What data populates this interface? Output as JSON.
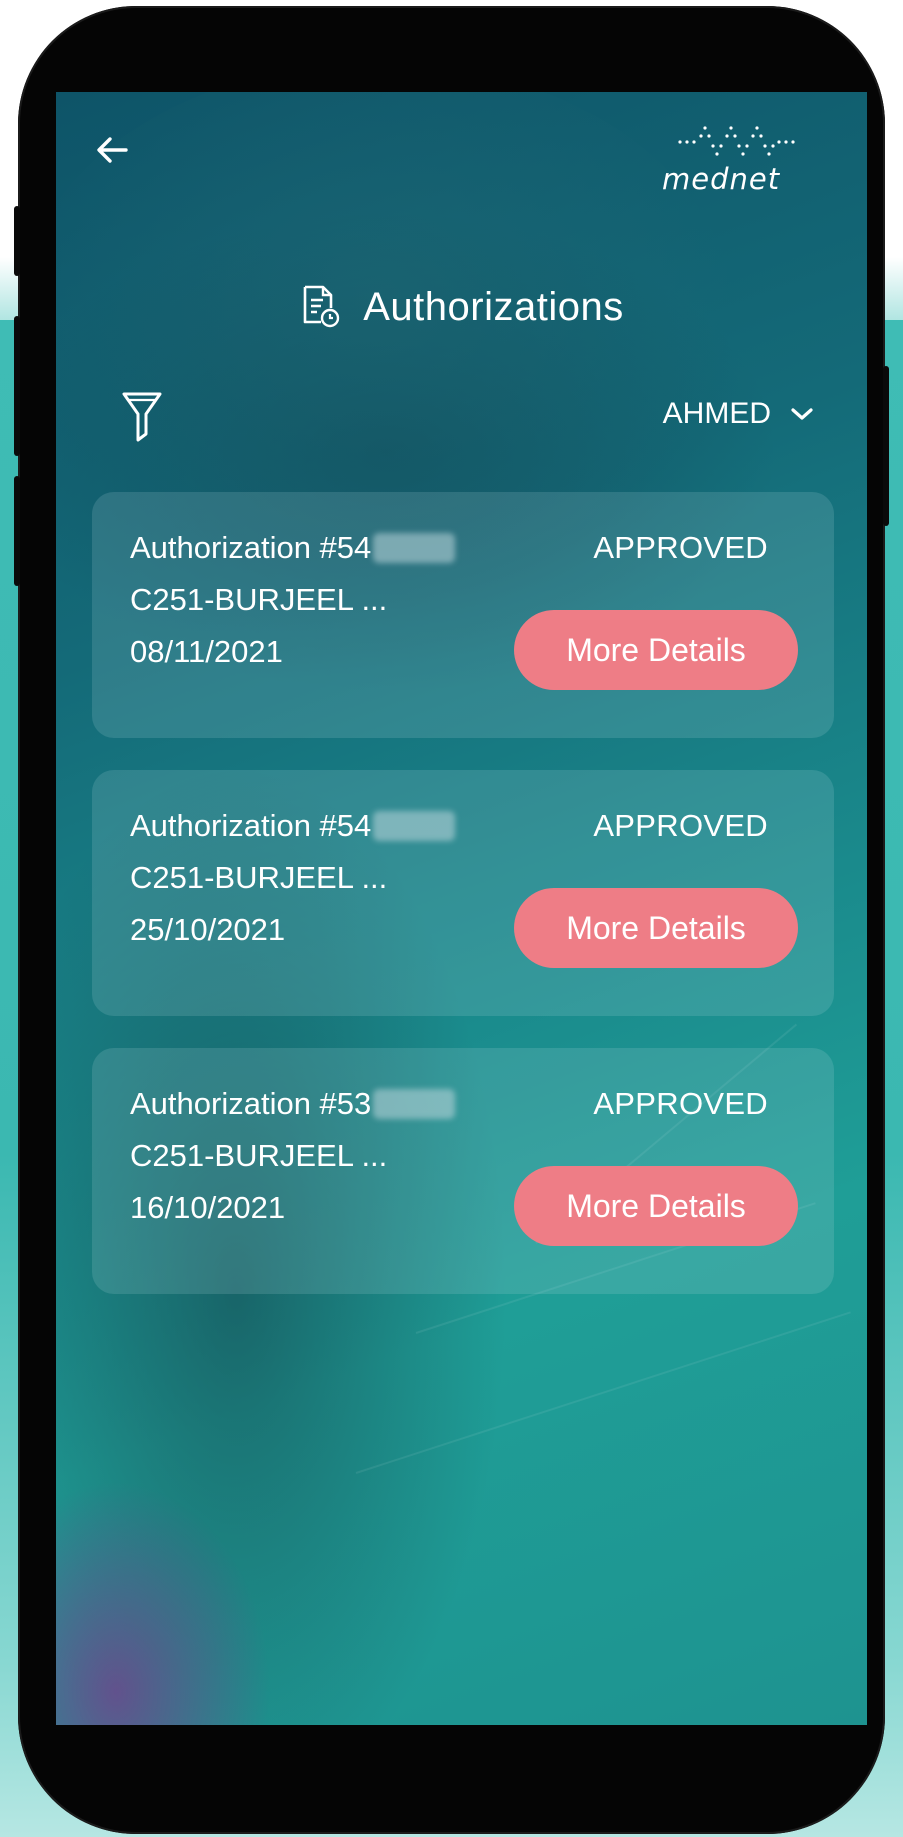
{
  "header": {
    "logo_text": "mednet",
    "title": "Authorizations"
  },
  "member_select": {
    "selected": "AHMED"
  },
  "authorizations": [
    {
      "title": "Authorization #54",
      "provider": "C251-BURJEEL ...",
      "date": "08/11/2021",
      "status": "APPROVED",
      "button_label": "More Details"
    },
    {
      "title": "Authorization #54",
      "provider": "C251-BURJEEL ...",
      "date": "25/10/2021",
      "status": "APPROVED",
      "button_label": "More Details"
    },
    {
      "title": "Authorization #53",
      "provider": "C251-BURJEEL ...",
      "date": "16/10/2021",
      "status": "APPROVED",
      "button_label": "More Details"
    }
  ],
  "icons": {
    "back": "arrow-left-icon",
    "logo": "mednet-logo",
    "page": "document-clock-icon",
    "filter": "filter-icon",
    "dropdown": "chevron-down-icon"
  },
  "colors": {
    "button": "#ee7d86",
    "status_text": "#ffffff",
    "accent": "#3fbcb5"
  }
}
